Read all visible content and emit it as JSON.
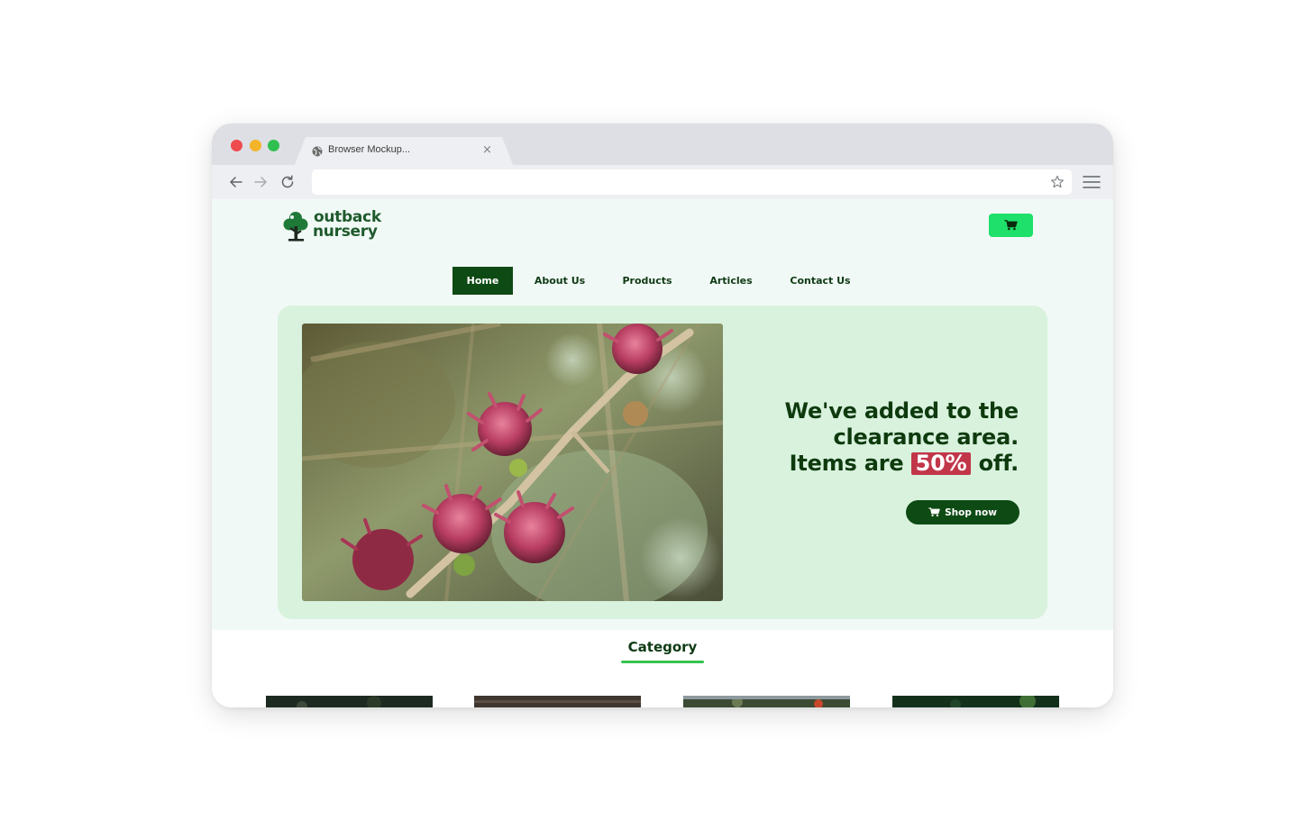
{
  "browser": {
    "tab_title": "Browser Mockup...",
    "tab_close": "×",
    "url": ""
  },
  "site": {
    "logo_line1": "outback",
    "logo_line2": "nursery",
    "nav": [
      {
        "label": "Home",
        "active": true
      },
      {
        "label": "About Us",
        "active": false
      },
      {
        "label": "Products",
        "active": false
      },
      {
        "label": "Articles",
        "active": false
      },
      {
        "label": "Contact Us",
        "active": false
      }
    ],
    "hero": {
      "line1": "We've added to the",
      "line2": "clearance area.",
      "line3_prefix": "Items are",
      "discount": "50%",
      "line3_suffix": "off.",
      "button_label": "Shop now"
    },
    "category": {
      "title": "Category"
    }
  },
  "colors": {
    "brand_dark": "#0e4a14",
    "accent_green": "#1ee06a",
    "hero_bg": "#d8f2dd",
    "discount_red": "#c2364a",
    "underline": "#35c34f"
  },
  "icons": [
    "globe-icon",
    "back-arrow-icon",
    "forward-arrow-icon",
    "reload-icon",
    "star-icon",
    "hamburger-menu-icon",
    "cart-icon",
    "tree-logo-icon"
  ]
}
